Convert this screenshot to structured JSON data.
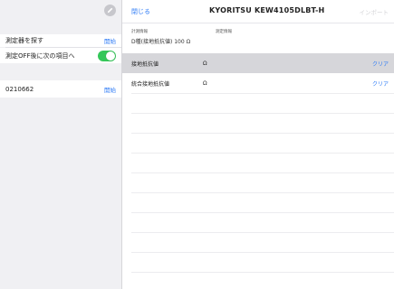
{
  "left_panel": {
    "rows": [
      {
        "label": "測定器を探す",
        "action": "開始"
      },
      {
        "label": "測定OFF後に次の項目へ",
        "toggle_on": true
      },
      {
        "label": "0210662",
        "action": "開始"
      }
    ]
  },
  "header": {
    "close_label": "閉じる",
    "title": "KYORITSU KEW4105DLBT-H",
    "import_label": "インポート"
  },
  "info": {
    "label1": "計測情報",
    "label2": "測定情報",
    "value1": "D種(接地抵抗値) 100 Ω"
  },
  "measurements": [
    {
      "label": "接地抵抗値",
      "unit": "Ω",
      "action": "クリア",
      "selected": true
    },
    {
      "label": "統合接地抵抗値",
      "unit": "Ω",
      "action": "クリア",
      "selected": false
    }
  ],
  "colors": {
    "accent": "#2f7cf6",
    "toggle_on": "#34c759",
    "selected_row": "#d6d6da"
  }
}
